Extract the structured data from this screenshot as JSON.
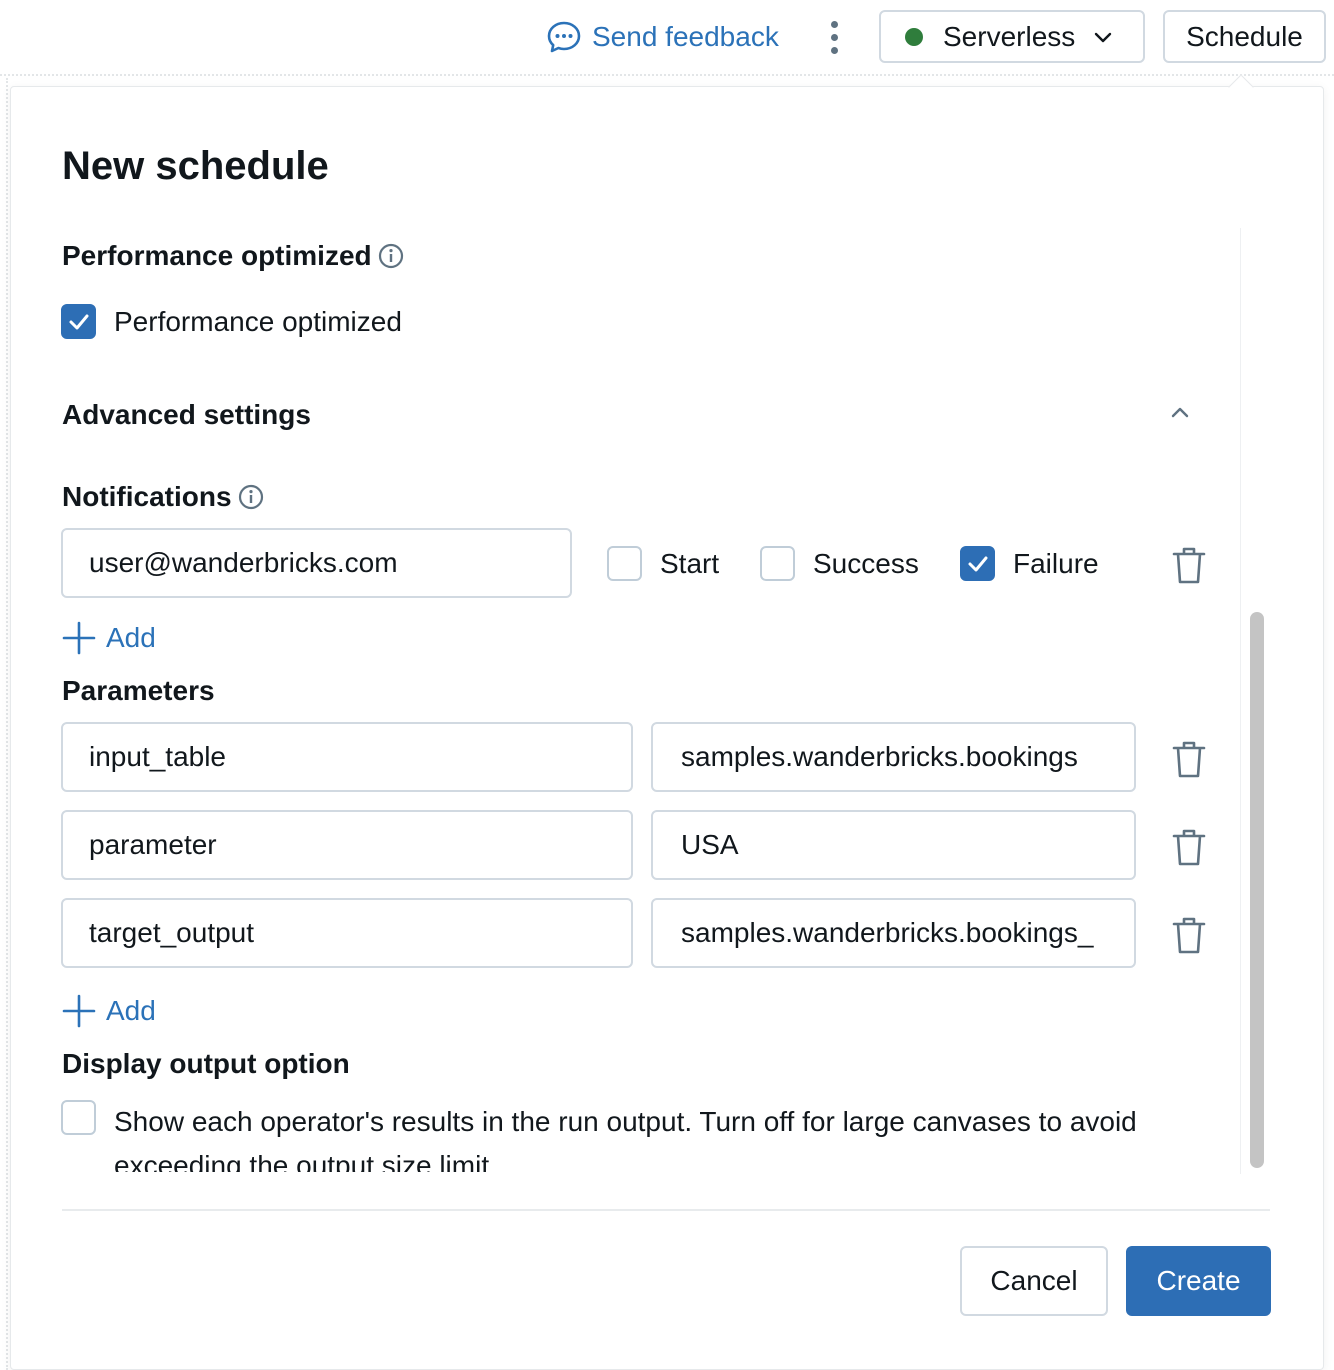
{
  "topbar": {
    "feedback_label": "Send feedback",
    "compute_label": "Serverless",
    "compute_status_color": "#2f7d3c",
    "schedule_label": "Schedule",
    "icons": [
      "chat-feedback-icon",
      "kebab-menu-icon",
      "chevron-down-icon"
    ]
  },
  "dialog": {
    "title": "New schedule",
    "performance": {
      "heading": "Performance optimized",
      "checkbox_label": "Performance optimized",
      "checked": true
    },
    "advanced": {
      "heading": "Advanced settings",
      "expanded": true
    },
    "notifications": {
      "heading": "Notifications",
      "email": "user@wanderbricks.com",
      "start_label": "Start",
      "start_checked": false,
      "success_label": "Success",
      "success_checked": false,
      "failure_label": "Failure",
      "failure_checked": true,
      "add_label": "Add"
    },
    "parameters": {
      "heading": "Parameters",
      "rows": [
        {
          "key": "input_table",
          "value": "samples.wanderbricks.bookings"
        },
        {
          "key": "parameter",
          "value": "USA"
        },
        {
          "key": "target_output",
          "value": "samples.wanderbricks.bookings_"
        }
      ],
      "add_label": "Add"
    },
    "display_output": {
      "heading": "Display output option",
      "checkbox_label": "Show each operator's results in the run output. Turn off for large canvases to avoid exceeding the output size limit.",
      "checked": false
    },
    "cancel_label": "Cancel",
    "create_label": "Create",
    "accent_color": "#2d6eb5"
  }
}
